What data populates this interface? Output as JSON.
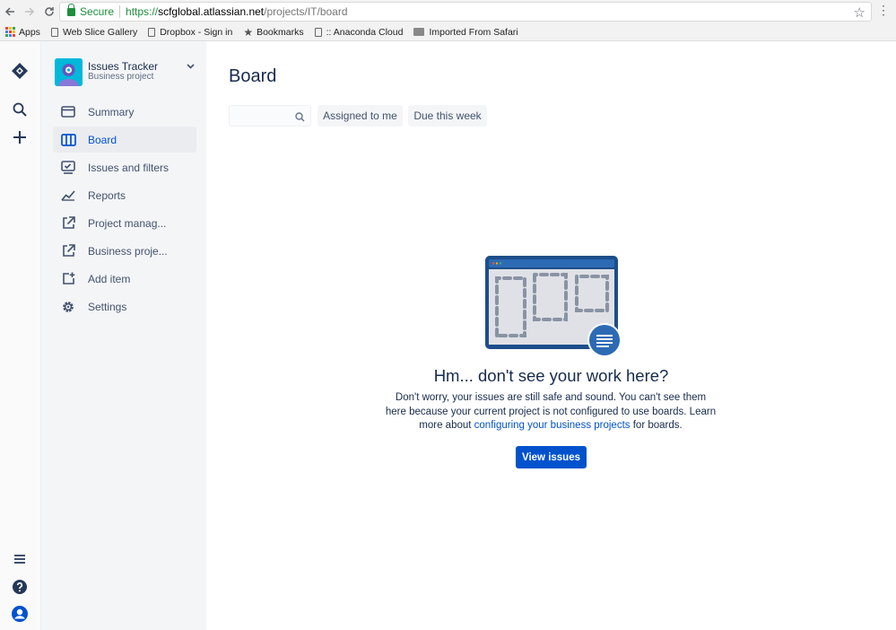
{
  "browser": {
    "secure_label": "Secure",
    "url_scheme": "https://",
    "url_host": "scfglobal.atlassian.net",
    "url_path": "/projects/IT/board",
    "bookmarks": [
      {
        "label": "Apps",
        "icon": "apps-grid-icon"
      },
      {
        "label": "Web Slice Gallery",
        "icon": "page-icon"
      },
      {
        "label": "Dropbox - Sign in",
        "icon": "page-icon"
      },
      {
        "label": "Bookmarks",
        "icon": "star-icon"
      },
      {
        "label": ":: Anaconda Cloud",
        "icon": "page-icon"
      },
      {
        "label": "Imported From Safari",
        "icon": "folder-icon"
      }
    ]
  },
  "project": {
    "name": "Issues Tracker",
    "type": "Business project"
  },
  "sidebar": {
    "items": [
      {
        "label": "Summary",
        "icon": "summary-icon",
        "active": false
      },
      {
        "label": "Board",
        "icon": "board-icon",
        "active": true
      },
      {
        "label": "Issues and filters",
        "icon": "issues-icon",
        "active": false
      },
      {
        "label": "Reports",
        "icon": "reports-icon",
        "active": false
      },
      {
        "label": "Project manag...",
        "icon": "external-link-icon",
        "active": false
      },
      {
        "label": "Business proje...",
        "icon": "external-link-icon",
        "active": false
      },
      {
        "label": "Add item",
        "icon": "add-item-icon",
        "active": false
      },
      {
        "label": "Settings",
        "icon": "gear-icon",
        "active": false
      }
    ]
  },
  "main": {
    "title": "Board",
    "search": {
      "placeholder": "",
      "value": ""
    },
    "filters": [
      "Assigned to me",
      "Due this week"
    ],
    "empty_state": {
      "title": "Hm... don't see your work here?",
      "body_before": "Don't worry, your issues are still safe and sound. You can't see them here because your current project is not configured to use boards. Learn more about ",
      "link": "configuring your business projects",
      "body_after": " for boards.",
      "button": "View issues"
    }
  },
  "colors": {
    "accent": "#0052CC",
    "sidebar_bg": "#F4F5F7",
    "text": "#172B4D",
    "secure": "#1E8E3E"
  }
}
